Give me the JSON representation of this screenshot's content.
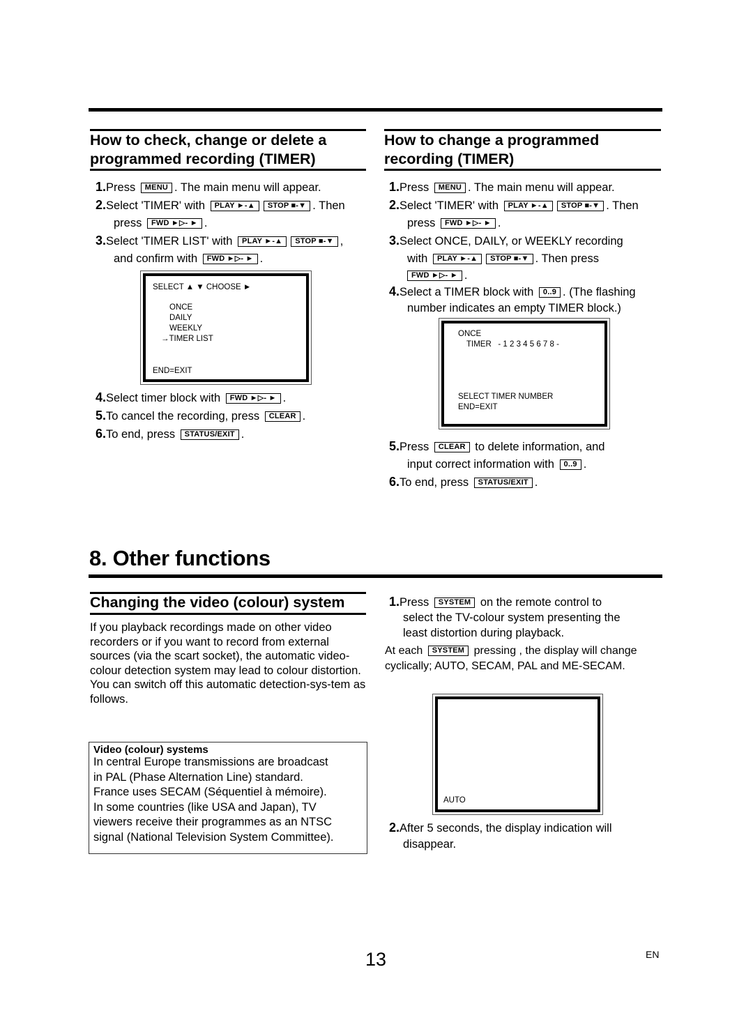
{
  "keys": {
    "menu": "MENU",
    "play": "PLAY ►-▲",
    "stop": "STOP ■-▼",
    "fwd": "FWD ►▷- ►",
    "clear": "CLEAR",
    "status_exit": "STATUS/EXIT",
    "digits": "0..9",
    "system": "SYSTEM"
  },
  "left_section": {
    "title_line1": "How to check, change or delete a",
    "title_line2": "programmed recording (TIMER)",
    "steps": [
      {
        "num": "1.",
        "a": "Press",
        "b": ". The main menu will appear."
      },
      {
        "num": "2.",
        "a": "Select 'TIMER' with",
        "b": ". Then",
        "c": "press",
        "d": "."
      },
      {
        "num": "3.",
        "a": "Select 'TIMER LIST' with",
        "b": ",",
        "c": "and confirm with",
        "d": "."
      },
      {
        "num": "4.",
        "a": "Select timer block with",
        "b": "."
      },
      {
        "num": "5.",
        "a": "To cancel the recording, press",
        "b": "."
      },
      {
        "num": "6.",
        "a": "To end, press",
        "b": "."
      }
    ],
    "osd": {
      "select": "SELECT ▲ ▼  CHOOSE ►",
      "items": [
        "ONCE",
        "DAILY",
        "WEEKLY",
        "→TIMER LIST"
      ],
      "footer": "END=EXIT"
    }
  },
  "right_section": {
    "title_line1": "How to change a programmed",
    "title_line2": "recording (TIMER)",
    "steps": [
      {
        "num": "1.",
        "a": "Press",
        "b": ". The main menu will appear."
      },
      {
        "num": "2.",
        "a": "Select 'TIMER' with",
        "b": ". Then",
        "c": "press",
        "d": "."
      },
      {
        "num": "3.",
        "a": "Select ONCE, DAILY, or WEEKLY recording",
        "c": "with",
        "d": ". Then press",
        "e": "."
      },
      {
        "num": "4.",
        "a": "Select a TIMER block with",
        "b": ". (The flashing",
        "c": "number indicates an empty TIMER block.)"
      },
      {
        "num": "5.",
        "a": "Press",
        "b": "to delete information, and",
        "c": "input correct information with",
        "d": "."
      },
      {
        "num": "6.",
        "a": "To end, press",
        "b": "."
      }
    ],
    "osd": {
      "line1": "ONCE",
      "line2": "TIMER   - 1 2 3 4 5 6 7 8 -",
      "line3": "SELECT TIMER NUMBER",
      "footer": "END=EXIT"
    }
  },
  "chapter": {
    "title": "8. Other functions"
  },
  "colour_section": {
    "title": "Changing the video (colour) system",
    "para1": "If you playback recordings made on other video recorders or if you want to record from external sources (via the scart socket), the automatic video-colour detection system may lead to colour distortion.",
    "para2": "You can switch off this automatic detection-sys-tem as follows.",
    "info_title": "Video (colour) systems",
    "info_lines": [
      "In central Europe transmissions are broadcast",
      "in PAL (Phase Alternation Line) standard.",
      "France uses SECAM (Séquentiel à mémoire).",
      "In some countries (like USA and Japan), TV",
      "viewers receive their programmes as an NTSC",
      "signal (National Television System Committee)."
    ],
    "step1": {
      "num": "1.",
      "a": "Press",
      "b": "on the remote control to",
      "c": "select the TV-colour system presenting the",
      "d": "least distortion during playback."
    },
    "note_a": "At each",
    "note_b": "pressing , the display will change",
    "note_c": "cyclically; AUTO, SECAM, PAL and ME-SECAM.",
    "osd_label": "AUTO",
    "step2": {
      "num": "2.",
      "a": "After 5 seconds, the display indication will",
      "b": "disappear."
    }
  },
  "footer": {
    "page_number": "13",
    "language": "EN"
  }
}
